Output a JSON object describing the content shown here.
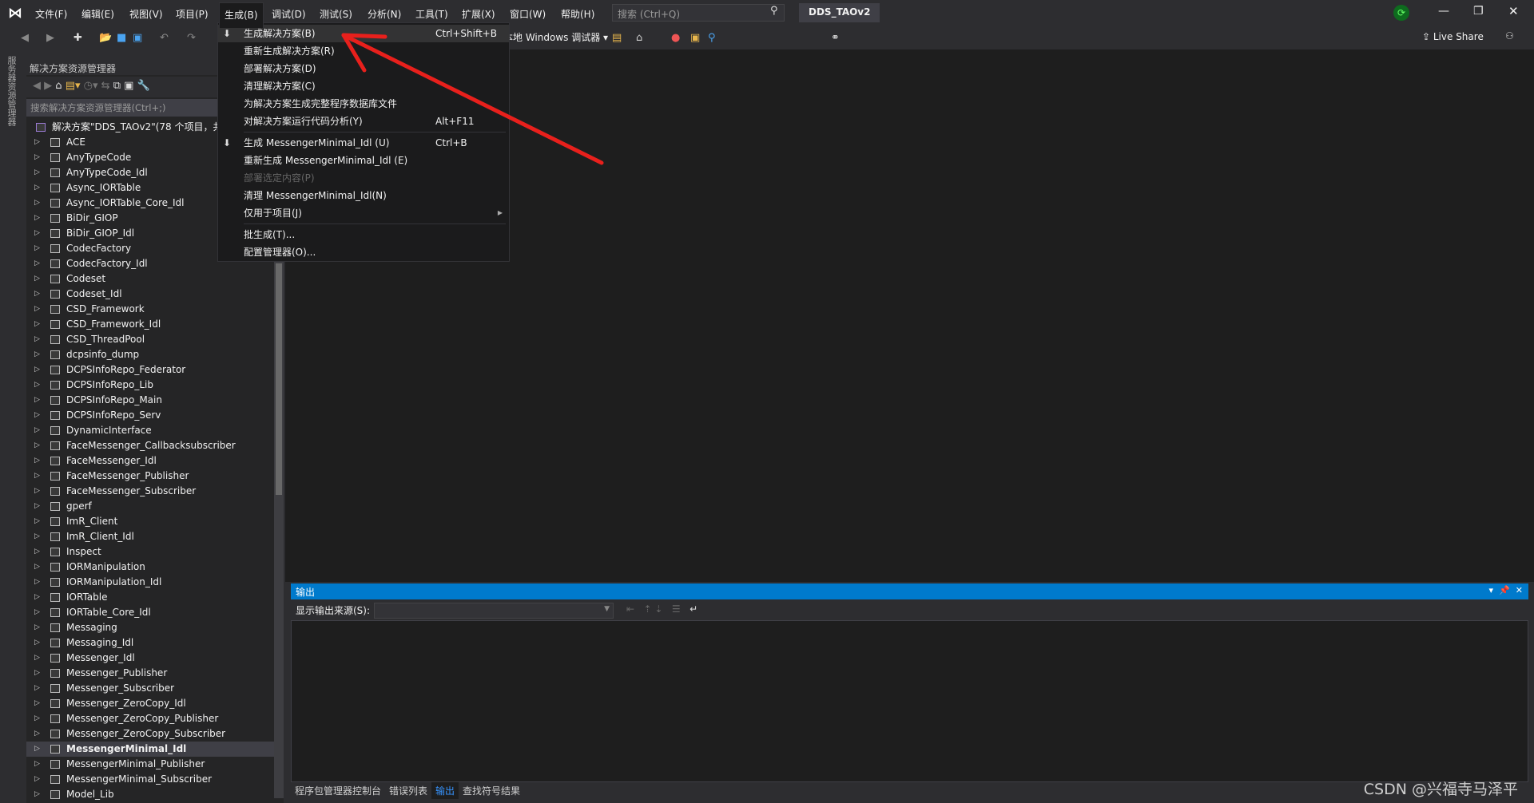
{
  "titlebar": {
    "menus": [
      "文件(F)",
      "编辑(E)",
      "视图(V)",
      "项目(P)",
      "生成(B)",
      "调试(D)",
      "测试(S)",
      "分析(N)",
      "工具(T)",
      "扩展(X)",
      "窗口(W)",
      "帮助(H)"
    ],
    "search_placeholder": "搜索 (Ctrl+Q)",
    "solution_name": "DDS_TAOv2"
  },
  "toolbar": {
    "debugger": "本地 Windows 调试器",
    "live_share": "Live Share"
  },
  "side_tab": "服务器资源管理器",
  "solution_explorer": {
    "title": "解决方案资源管理器",
    "search_placeholder": "搜索解决方案资源管理器(Ctrl+;)",
    "root": "解决方案\"DDS_TAOv2\"(78 个项目，共",
    "items": [
      "ACE",
      "AnyTypeCode",
      "AnyTypeCode_Idl",
      "Async_IORTable",
      "Async_IORTable_Core_Idl",
      "BiDir_GIOP",
      "BiDir_GIOP_Idl",
      "CodecFactory",
      "CodecFactory_Idl",
      "Codeset",
      "Codeset_Idl",
      "CSD_Framework",
      "CSD_Framework_Idl",
      "CSD_ThreadPool",
      "dcpsinfo_dump",
      "DCPSInfoRepo_Federator",
      "DCPSInfoRepo_Lib",
      "DCPSInfoRepo_Main",
      "DCPSInfoRepo_Serv",
      "DynamicInterface",
      "FaceMessenger_Callbacksubscriber",
      "FaceMessenger_Idl",
      "FaceMessenger_Publisher",
      "FaceMessenger_Subscriber",
      "gperf",
      "ImR_Client",
      "ImR_Client_Idl",
      "Inspect",
      "IORManipulation",
      "IORManipulation_Idl",
      "IORTable",
      "IORTable_Core_Idl",
      "Messaging",
      "Messaging_Idl",
      "Messenger_Idl",
      "Messenger_Publisher",
      "Messenger_Subscriber",
      "Messenger_ZeroCopy_Idl",
      "Messenger_ZeroCopy_Publisher",
      "Messenger_ZeroCopy_Subscriber",
      "MessengerMinimal_Idl",
      "MessengerMinimal_Publisher",
      "MessengerMinimal_Subscriber",
      "Model_Lib"
    ],
    "selected": "MessengerMinimal_Idl"
  },
  "build_menu": {
    "items": [
      {
        "label": "生成解决方案(B)",
        "shortcut": "Ctrl+Shift+B",
        "icon": "build-icon",
        "highlighted": true
      },
      {
        "label": "重新生成解决方案(R)"
      },
      {
        "label": "部署解决方案(D)"
      },
      {
        "label": "清理解决方案(C)"
      },
      {
        "label": "为解决方案生成完整程序数据库文件"
      },
      {
        "label": "对解决方案运行代码分析(Y)",
        "shortcut": "Alt+F11"
      },
      {
        "separator": true
      },
      {
        "label": "生成 MessengerMinimal_Idl (U)",
        "shortcut": "Ctrl+B",
        "icon": "build-icon"
      },
      {
        "label": "重新生成 MessengerMinimal_Idl (E)"
      },
      {
        "label": "部署选定内容(P)",
        "disabled": true
      },
      {
        "label": "清理 MessengerMinimal_Idl(N)"
      },
      {
        "label": "仅用于项目(J)",
        "submenu": true
      },
      {
        "separator": true
      },
      {
        "label": "批生成(T)..."
      },
      {
        "label": "配置管理器(O)..."
      }
    ]
  },
  "output": {
    "title": "输出",
    "source_label": "显示输出来源(S):",
    "source_value": ""
  },
  "bottom_tabs": [
    "程序包管理器控制台",
    "错误列表",
    "输出",
    "查找符号结果"
  ],
  "active_bottom_tab": "输出",
  "watermark": "CSDN @兴福寺马泽平",
  "colors": {
    "accent": "#007acc",
    "annotation_arrow": "#e8201c"
  }
}
